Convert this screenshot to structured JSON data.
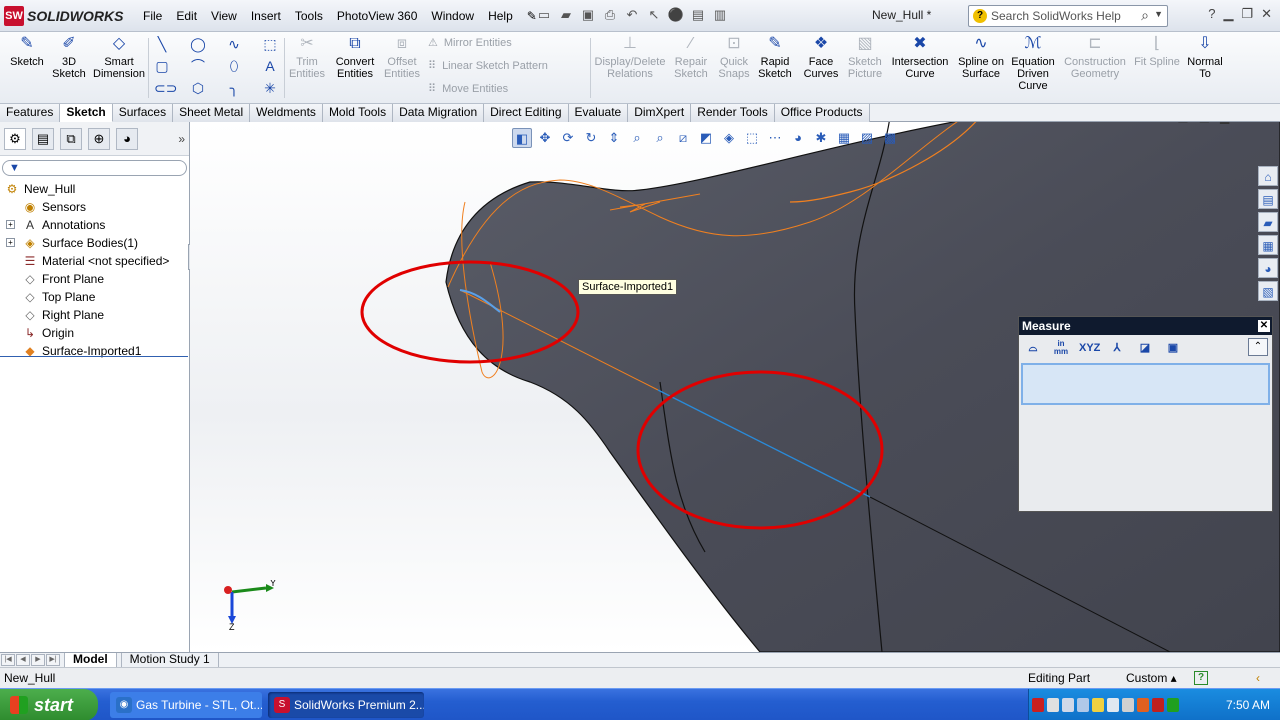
{
  "app": {
    "logo_text": "SOLIDWORKS",
    "document_title": "New_Hull *"
  },
  "menu": [
    "File",
    "Edit",
    "View",
    "Insert",
    "Tools",
    "PhotoView 360",
    "Window",
    "Help"
  ],
  "search": {
    "placeholder": "Search SolidWorks Help"
  },
  "toolbar": {
    "sketch": "Sketch",
    "sketch3d": "3D Sketch",
    "smart_dimension": "Smart Dimension",
    "trim_entities": "Trim Entities",
    "convert_entities": "Convert Entities",
    "offset_entities": "Offset Entities",
    "mirror_entities": "Mirror Entities",
    "linear_pattern": "Linear Sketch Pattern",
    "move_entities": "Move Entities",
    "display_delete_relations": "Display/Delete Relations",
    "repair_sketch": "Repair Sketch",
    "quick_snaps": "Quick Snaps",
    "rapid_sketch": "Rapid Sketch",
    "face_curves": "Face Curves",
    "sketch_picture": "Sketch Picture",
    "intersection_curve": "Intersection Curve",
    "spline_on_surface": "Spline on Surface",
    "equation_driven_curve": "Equation Driven Curve",
    "construction_geometry": "Construction Geometry",
    "fit_spline": "Fit Spline",
    "normal_to": "Normal To"
  },
  "tabs": [
    "Features",
    "Sketch",
    "Surfaces",
    "Sheet Metal",
    "Weldments",
    "Mold Tools",
    "Data Migration",
    "Direct Editing",
    "Evaluate",
    "DimXpert",
    "Render Tools",
    "Office Products"
  ],
  "active_tab": "Sketch",
  "feature_tree": [
    {
      "label": "New_Hull",
      "icon": "part-icon",
      "expandable": false
    },
    {
      "label": "Sensors",
      "icon": "sensors-icon",
      "expandable": false
    },
    {
      "label": "Annotations",
      "icon": "annotations-icon",
      "expandable": true
    },
    {
      "label": "Surface Bodies(1)",
      "icon": "surface-bodies-icon",
      "expandable": true
    },
    {
      "label": "Material <not specified>",
      "icon": "material-icon",
      "expandable": false
    },
    {
      "label": "Front Plane",
      "icon": "plane-icon",
      "expandable": false
    },
    {
      "label": "Top Plane",
      "icon": "plane-icon",
      "expandable": false
    },
    {
      "label": "Right Plane",
      "icon": "plane-icon",
      "expandable": false
    },
    {
      "label": "Origin",
      "icon": "origin-icon",
      "expandable": false
    },
    {
      "label": "Surface-Imported1",
      "icon": "imported-surface-icon",
      "expandable": false
    }
  ],
  "viewport": {
    "tooltip": "Surface-Imported1",
    "triad_y": "Y",
    "triad_z": "Z"
  },
  "measure": {
    "title": "Measure",
    "units_label_top": "in",
    "units_label_bottom": "mm",
    "xyz_label": "XYZ"
  },
  "bottom_tabs": [
    "Model",
    "Motion Study 1"
  ],
  "active_bottom_tab": "Model",
  "status": {
    "left": "New_Hull",
    "mode": "Editing Part",
    "units": "Custom"
  },
  "taskbar": {
    "start": "start",
    "tasks": [
      "Gas Turbine - STL, Ot...",
      "SolidWorks Premium 2..."
    ],
    "clock": "7:50 AM"
  },
  "colors": {
    "model_surface": "#4a4c57",
    "sketch_orange": "#f08020",
    "highlight_blue": "#2a8ad8",
    "annotation_red": "#e00000"
  }
}
